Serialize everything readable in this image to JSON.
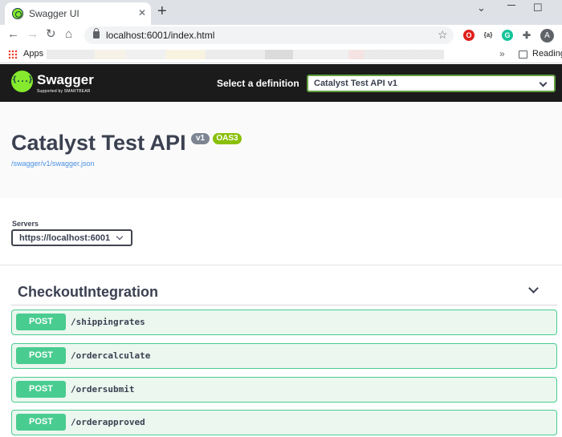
{
  "browser": {
    "tab_title": "Swagger UI",
    "tab_close": "✕",
    "new_tab": "+",
    "url": "localhost:6001/index.html",
    "bookmarks": {
      "apps_label": "Apps",
      "more": "»",
      "reading_label": "Reading l"
    },
    "avatar_initial": "A",
    "win_min": "⌄",
    "win_restore": "☐"
  },
  "topbar": {
    "brand": "Swagger",
    "brand_sub": "Supported by SMARTBEAR",
    "select_label": "Select a definition",
    "definition": "Catalyst Test API v1",
    "colors": {
      "background": "#1b1b1b",
      "brand_green": "#85ea2d"
    }
  },
  "info": {
    "title": "Catalyst Test API",
    "version_badge": "v1",
    "oas_badge": "OAS3",
    "spec_link": "/swagger/v1/swagger.json"
  },
  "servers": {
    "label": "Servers",
    "selected": "https://localhost:6001"
  },
  "tag": {
    "name": "CheckoutIntegration",
    "expanded": true
  },
  "operations": [
    {
      "method": "POST",
      "path": "/shippingrates"
    },
    {
      "method": "POST",
      "path": "/ordercalculate"
    },
    {
      "method": "POST",
      "path": "/ordersubmit"
    },
    {
      "method": "POST",
      "path": "/orderapproved"
    }
  ],
  "colors": {
    "post": "#49cc90",
    "post_bg": "#ebf7ef",
    "link": "#4990e2"
  }
}
